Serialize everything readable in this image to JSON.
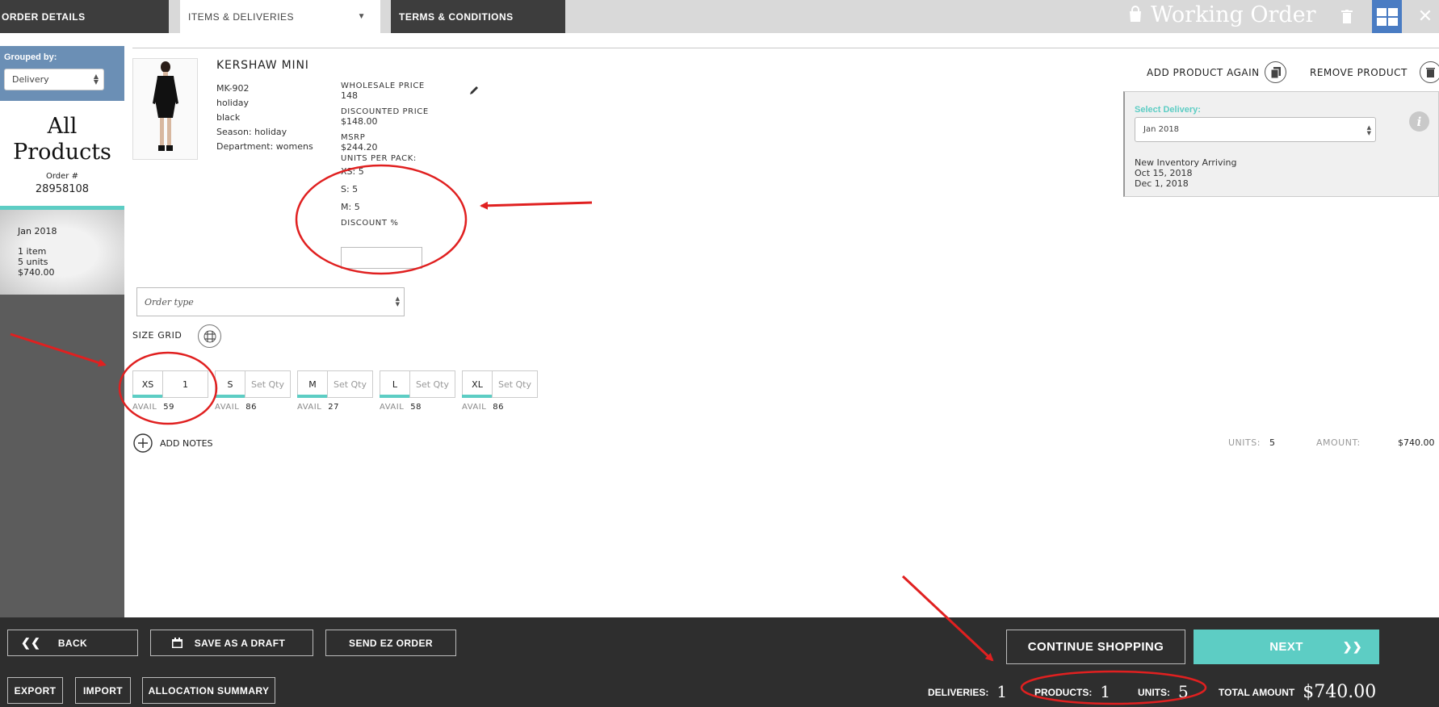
{
  "tabs": [
    {
      "label": "ORDER DETAILS"
    },
    {
      "label": "ITEMS & DELIVERIES"
    },
    {
      "label": "TERMS & CONDITIONS"
    }
  ],
  "header": {
    "title": "Working Order",
    "icons": [
      "bag-icon",
      "trash-icon",
      "grid-view-icon",
      "close-icon"
    ]
  },
  "sidebar": {
    "grouped_label": "Grouped by:",
    "grouped_value": "Delivery",
    "all_products_line1": "All",
    "all_products_line2": "Products",
    "order_label": "Order #",
    "order_number": "28958108",
    "delivery": {
      "date": "Jan 2018",
      "items": "1 item",
      "units": "5 units",
      "amount": "$740.00"
    }
  },
  "product": {
    "name": "KERSHAW MINI",
    "sku": "MK-902",
    "collection": "holiday",
    "color": "black",
    "season": "Season: holiday",
    "department": "Department: womens",
    "wholesale_label": "WHOLESALE PRICE",
    "wholesale_value": "148",
    "discounted_label": "DISCOUNTED PRICE",
    "discounted_value": "$148.00",
    "msrp_label": "MSRP",
    "msrp_value": "$244.20",
    "units_per_pack_label": "UNITS PER PACK:",
    "packs": [
      "XS: 5",
      "S: 5",
      "M: 5"
    ],
    "discount_label": "DISCOUNT %",
    "discount_value": ""
  },
  "actions": {
    "add_again": "ADD PRODUCT AGAIN",
    "remove": "REMOVE PRODUCT"
  },
  "delivery_panel": {
    "select_label": "Select Delivery:",
    "select_value": "Jan 2018",
    "inventory_label": "New Inventory Arriving",
    "dates": [
      "Oct 15, 2018",
      "Dec 1, 2018"
    ]
  },
  "order_type": {
    "placeholder": "Order type"
  },
  "size_grid": {
    "label": "SIZE GRID",
    "avail_label": "AVAIL",
    "sizes": [
      {
        "size": "XS",
        "qty": "1",
        "avail": "59"
      },
      {
        "size": "S",
        "qty": "Set Qty",
        "avail": "86"
      },
      {
        "size": "M",
        "qty": "Set Qty",
        "avail": "27"
      },
      {
        "size": "L",
        "qty": "Set Qty",
        "avail": "58"
      },
      {
        "size": "XL",
        "qty": "Set Qty",
        "avail": "86"
      }
    ]
  },
  "notes": {
    "label": "ADD NOTES"
  },
  "line_totals": {
    "units_label": "UNITS:",
    "units_value": "5",
    "amount_label": "AMOUNT:",
    "amount_value": "$740.00"
  },
  "footer": {
    "back": "BACK",
    "save_draft": "SAVE AS A DRAFT",
    "send_ez": "SEND EZ ORDER",
    "export": "EXPORT",
    "import": "IMPORT",
    "allocation": "ALLOCATION SUMMARY",
    "continue": "CONTINUE SHOPPING",
    "next": "NEXT",
    "deliveries_label": "DELIVERIES:",
    "deliveries_value": "1",
    "products_label": "PRODUCTS:",
    "products_value": "1",
    "units_label": "UNITS:",
    "units_value": "5",
    "total_label": "TOTAL AMOUNT",
    "total_value": "$740.00"
  },
  "colors": {
    "accent": "#5dcdc4",
    "dark": "#2e2e2e",
    "sidebar_blue": "#6b8fb5",
    "annotation": "#e02020"
  }
}
